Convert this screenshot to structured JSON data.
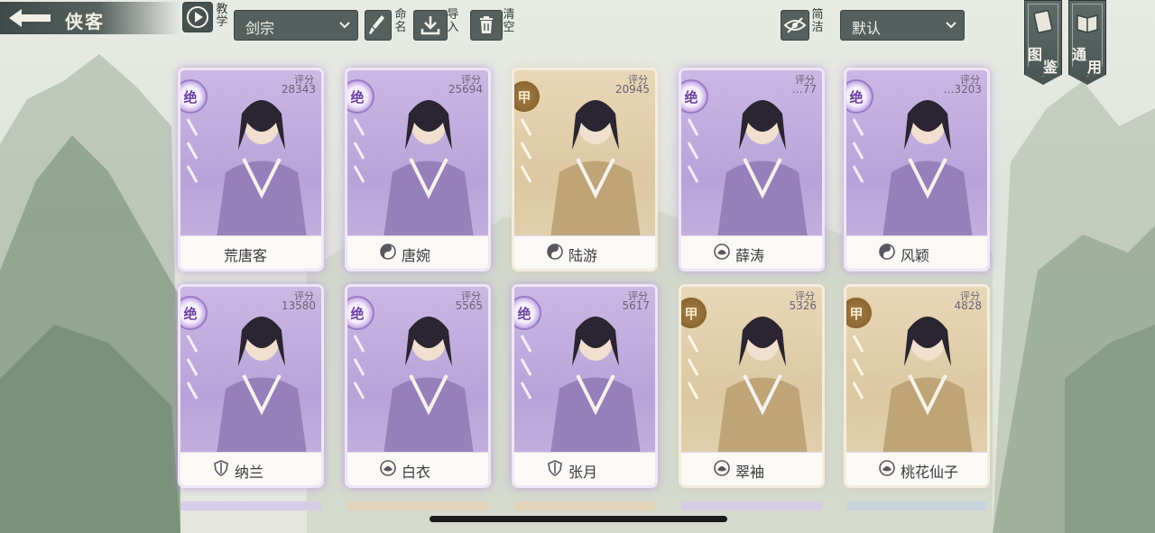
{
  "header": {
    "title": "侠客",
    "tutorial_label": "教学",
    "sect_filter": "剑宗",
    "rename_label": "命名",
    "import_label": "导入",
    "clear_label": "清空",
    "simple_label": "简洁",
    "sort_select": "默认"
  },
  "side_tabs": [
    {
      "line1": "图",
      "line2": "鉴"
    },
    {
      "line1": "通",
      "line2": "用"
    }
  ],
  "cards": [
    {
      "name": "荒唐客",
      "grade": "绝",
      "score_label": "评分",
      "score": "28343",
      "clan": "none",
      "rarity": "purple"
    },
    {
      "name": "唐婉",
      "grade": "绝",
      "score_label": "评分",
      "score": "25694",
      "clan": "yin-yang",
      "rarity": "purple"
    },
    {
      "name": "陆游",
      "grade": "甲",
      "score_label": "评分",
      "score": "20945",
      "clan": "yin-yang",
      "rarity": "gold"
    },
    {
      "name": "薛涛",
      "grade": "绝",
      "score_label": "评分",
      "score": "…77",
      "clan": "lotus",
      "rarity": "purple"
    },
    {
      "name": "风颖",
      "grade": "绝",
      "score_label": "评分",
      "score": "…3203",
      "clan": "yin-yang",
      "rarity": "purple"
    },
    {
      "name": "纳兰",
      "grade": "绝",
      "score_label": "评分",
      "score": "13580",
      "clan": "shield",
      "rarity": "purple"
    },
    {
      "name": "白衣",
      "grade": "绝",
      "score_label": "评分",
      "score": "5565",
      "clan": "lotus",
      "rarity": "purple"
    },
    {
      "name": "张月",
      "grade": "绝",
      "score_label": "评分",
      "score": "5617",
      "clan": "shield",
      "rarity": "purple"
    },
    {
      "name": "翠袖",
      "grade": "甲",
      "score_label": "评分",
      "score": "5326",
      "clan": "lotus",
      "rarity": "gold"
    },
    {
      "name": "桃花仙子",
      "grade": "甲",
      "score_label": "评分",
      "score": "4828",
      "clan": "lotus",
      "rarity": "gold"
    }
  ],
  "colors": {
    "purple_card": "#b8a3d9",
    "gold_card": "#dcc8a2",
    "toolbar": "#55605e"
  }
}
